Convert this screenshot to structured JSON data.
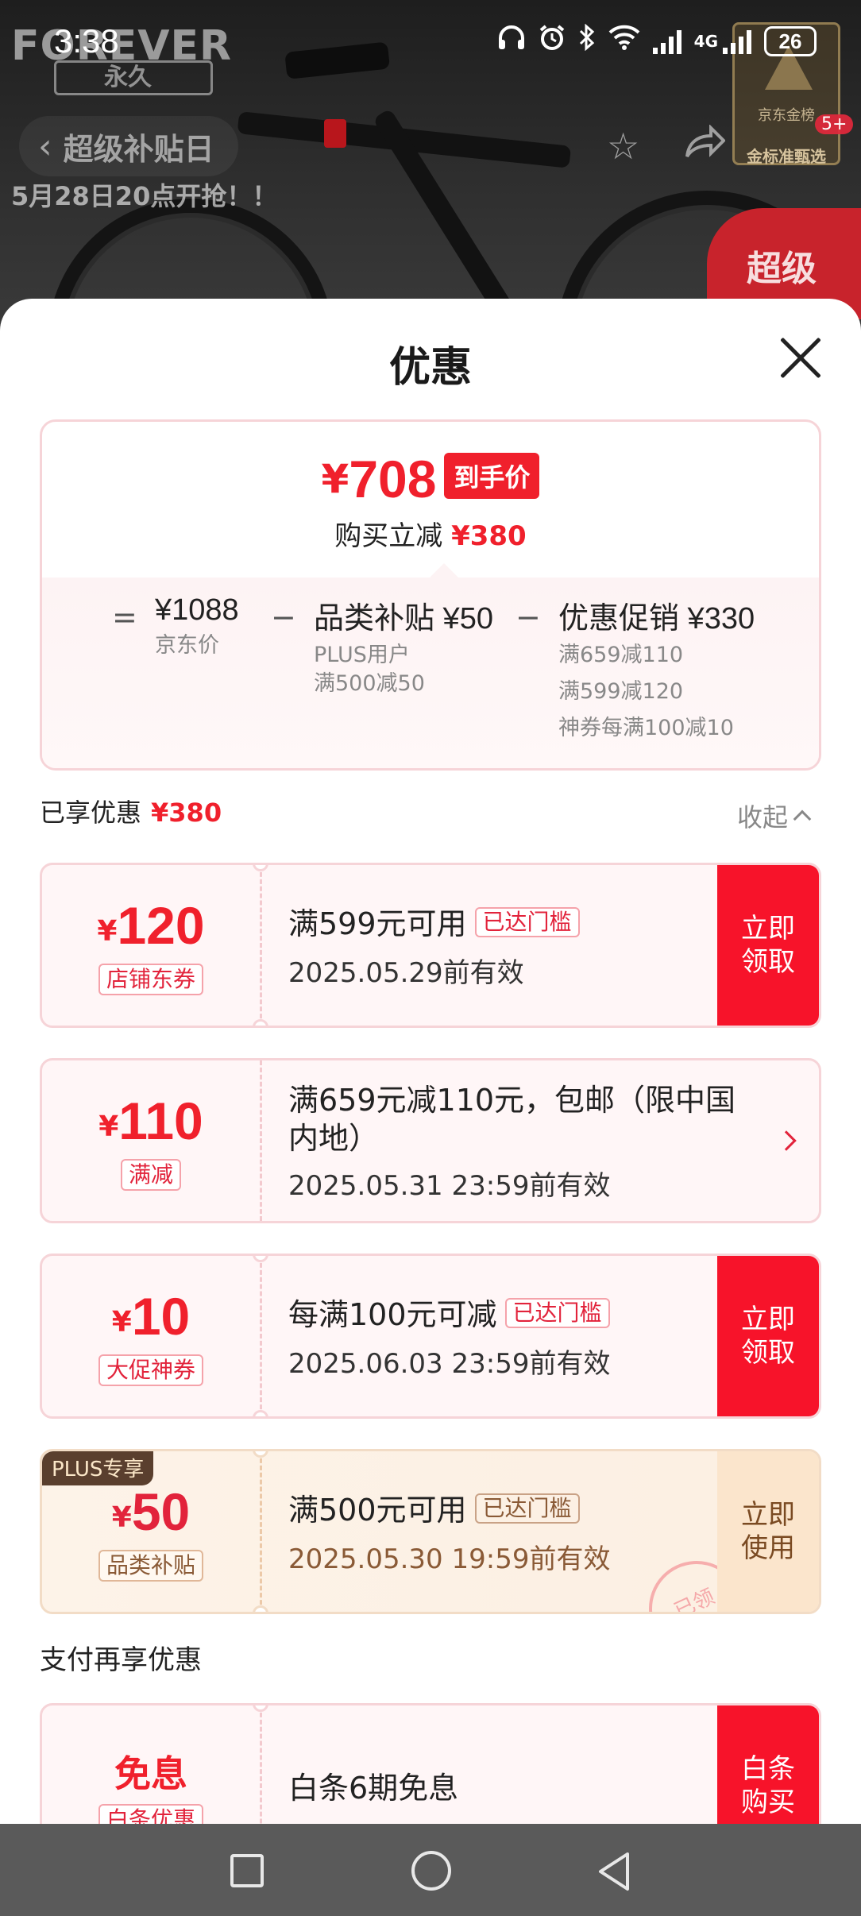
{
  "status_bar": {
    "time": "3:38",
    "battery": "26",
    "network": "4G"
  },
  "background": {
    "brand": "FOREVER",
    "brand_sub": "永久",
    "nav_title": "超级补贴日",
    "promo_time": "5月28日20点开抢！！",
    "rank_label": "京东金榜",
    "rank_sub": "金标准甄选",
    "badge_count": "5+",
    "red_promo": "超级"
  },
  "sheet": {
    "title": "优惠",
    "price_card": {
      "yen": "¥",
      "final_price": "708",
      "final_tag": "到手价",
      "cut_label": "购买立减",
      "cut_value": "¥380",
      "equals": "=",
      "minus": "−",
      "jd_price": "¥1088",
      "jd_price_label": "京东价",
      "category_label": "品类补贴 ¥50",
      "category_sub1": "PLUS用户",
      "category_sub2": "满500减50",
      "promo_label": "优惠促销 ¥330",
      "promo_sub1": "满659减110",
      "promo_sub2": "满599减120",
      "promo_sub3": "神券每满100减10"
    },
    "enjoyed_label": "已享优惠",
    "enjoyed_value": "¥380",
    "collapse_label": "收起",
    "coupons": [
      {
        "yen": "¥",
        "amount": "120",
        "type": "店铺东券",
        "desc": "满599元可用",
        "badge": "已达门槛",
        "valid": "2025.05.29前有效",
        "action": "立即领取"
      },
      {
        "yen": "¥",
        "amount": "110",
        "type": "满减",
        "desc": "满659元减110元，包邮（限中国内地）",
        "valid": "2025.05.31 23:59前有效"
      },
      {
        "yen": "¥",
        "amount": "10",
        "type": "大促神券",
        "desc": "每满100元可减",
        "badge": "已达门槛",
        "valid": "2025.06.03 23:59前有效",
        "action": "立即领取"
      },
      {
        "plus_tag": "PLUS专享",
        "yen": "¥",
        "amount": "50",
        "type": "品类补贴",
        "desc": "满500元可用",
        "badge": "已达门槛",
        "valid": "2025.05.30 19:59前有效",
        "action": "立即使用",
        "stamp": "已领"
      }
    ],
    "pay_title": "支付再享优惠",
    "pay_card": {
      "big": "免息",
      "type": "白条优惠",
      "desc": "白条6期免息",
      "action": "白条购买"
    }
  },
  "colors": {
    "accent_red": "#f0202c",
    "plus_brown": "#5a3f2e"
  }
}
